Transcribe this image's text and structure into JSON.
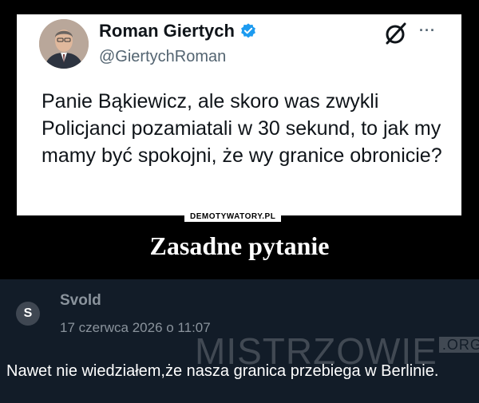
{
  "tweet": {
    "author_name": "Roman Giertych",
    "handle": "@GiertychRoman",
    "text": "Panie Bąkiewicz, ale skoro was zwykli Policjanci pozamiatali w 30 sekund, to jak my mamy być spokojni, że wy granice obronicie?",
    "more_label": "···",
    "icons": [
      "verified-badge-icon",
      "x-logo-icon",
      "more-options-icon"
    ],
    "verified_color": "#1d9bf0"
  },
  "meme": {
    "watermark": "DEMOTYWATORY.PL",
    "caption": "Zasadne pytanie"
  },
  "comment": {
    "avatar_letter": "S",
    "author": "Svold",
    "date": "17 czerwca 2026 o 11:07",
    "text": "Nawet nie wiedziałem,że nasza granica przebiega w Berlinie."
  },
  "site_watermark": {
    "main": "MISTRZOWIE",
    "suffix": ".ORG"
  },
  "colors": {
    "meme_background": "#000000",
    "comment_background": "#121c28",
    "comment_meta": "#8a939c"
  }
}
